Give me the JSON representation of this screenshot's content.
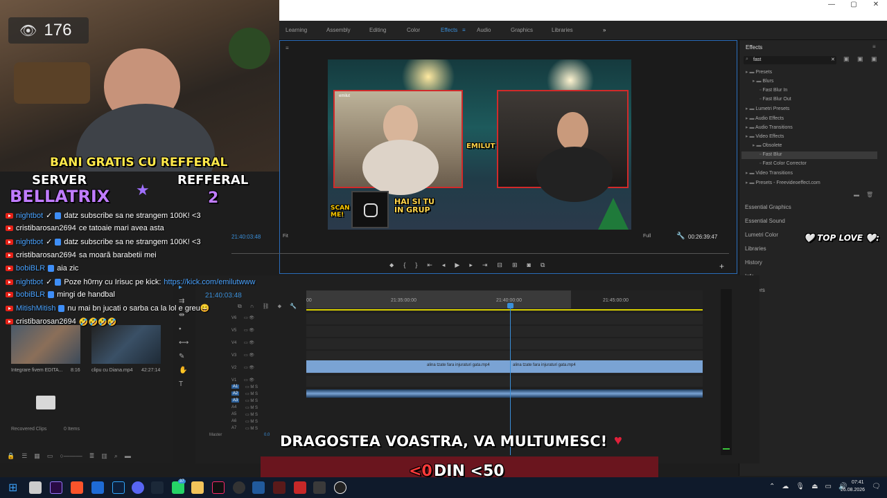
{
  "window": {
    "minimize": "—",
    "maximize": "▢",
    "close": "✕"
  },
  "workspace_tabs": [
    "Learning",
    "Assembly",
    "Editing",
    "Color",
    "Effects",
    "Audio",
    "Graphics",
    "Libraries"
  ],
  "active_tab": "Effects",
  "viewer_count": "176",
  "stream_banner": {
    "line1": "BANI GRATIS CU REFFERAL",
    "server_label": "SERVER",
    "server_name": "BELLATRIX",
    "refferal_label": "REFFERAL",
    "refferal_num": "2"
  },
  "chat": [
    {
      "user": "nightbot",
      "verified": true,
      "mod": true,
      "color": "blue",
      "text": "datz subscribe sa ne strangem 100K! <3"
    },
    {
      "user": "cristibarosan2694",
      "color": "white",
      "text": "ce tatoaie mari avea asta"
    },
    {
      "user": "nightbot",
      "verified": true,
      "mod": true,
      "color": "blue",
      "text": "datz subscribe sa ne strangem 100K! <3"
    },
    {
      "user": "cristibarosan2694",
      "color": "white",
      "text": "sa moară barabetii mei"
    },
    {
      "user": "bobiBLR",
      "mod": true,
      "color": "blue",
      "text": "aia zic"
    },
    {
      "user": "nightbot",
      "verified": true,
      "mod": true,
      "color": "blue",
      "text": "Poze h0rny cu Irisuc pe kick:",
      "link": "https://kick.com/emilutwww"
    },
    {
      "user": "bobiBLR",
      "mod": true,
      "color": "blue",
      "text": "mingi de handbal"
    },
    {
      "user": "MitishMitish",
      "mod": true,
      "color": "blue",
      "text": "nu mai bn jucati o sarba ca la lol e greu😄"
    },
    {
      "user": "cristibarosan2694",
      "color": "white",
      "text": "🤣🤣🤣🤣"
    }
  ],
  "program_monitor": {
    "timecode_left": "21:40:03:48",
    "fit": "Fit",
    "quality": "Full",
    "timecode_right": "00:26:39:47"
  },
  "video_overlay": {
    "group_text_1": "HAI SI TU",
    "group_text_2": "IN GRUP",
    "scan_1": "SCAN",
    "scan_2": "ME!",
    "emilut": "EMILUT",
    "cam_label": "emilut"
  },
  "effects_panel": {
    "title": "Effects",
    "search": "fast",
    "tree": [
      {
        "label": "Presets",
        "level": 0,
        "type": "folder"
      },
      {
        "label": "Blurs",
        "level": 1,
        "type": "folder"
      },
      {
        "label": "Fast Blur In",
        "level": 2,
        "type": "item"
      },
      {
        "label": "Fast Blur Out",
        "level": 2,
        "type": "item"
      },
      {
        "label": "Lumetri Presets",
        "level": 0,
        "type": "folder"
      },
      {
        "label": "Audio Effects",
        "level": 0,
        "type": "folder"
      },
      {
        "label": "Audio Transitions",
        "level": 0,
        "type": "folder"
      },
      {
        "label": "Video Effects",
        "level": 0,
        "type": "folder"
      },
      {
        "label": "Obsolete",
        "level": 1,
        "type": "folder"
      },
      {
        "label": "Fast Blur",
        "level": 2,
        "type": "item"
      },
      {
        "label": "Fast Color Corrector",
        "level": 2,
        "type": "item"
      },
      {
        "label": "Video Transitions",
        "level": 0,
        "type": "folder"
      },
      {
        "label": "Presets - Freevideoeffect.com",
        "level": 0,
        "type": "folder"
      }
    ],
    "selected": "Fast Blur"
  },
  "side_panels": [
    "Essential Graphics",
    "Essential Sound",
    "Lumetri Color",
    "Libraries",
    "History",
    "Info",
    "Markers"
  ],
  "top_love": "🤍 TOP LOVE 🤍:",
  "timeline": {
    "timecode": "21:40:03:48",
    "ruler": [
      "00",
      "21:35:00:00",
      "21:40:00:00",
      "21:45:00:00"
    ],
    "video_tracks": [
      "V6",
      "V5",
      "V4",
      "V3",
      "V2",
      "V1"
    ],
    "audio_tracks": [
      "A1",
      "A2",
      "A3",
      "A4",
      "A5",
      "A6",
      "A7"
    ],
    "master": "Master",
    "master_val": "0.0",
    "clip_name": "alina tzate fara injuraturi gata.mp4"
  },
  "project": {
    "clips": [
      {
        "name": "Integrare fivem EDITA...",
        "dur": "8:16"
      },
      {
        "name": "clipu cu Diana.mp4",
        "dur": "42:27:14"
      }
    ],
    "recovered": "Recovered Clips",
    "items": "0 Items"
  },
  "captions": {
    "line1": "DRAGOSTEA VOASTRA, VA MULTUMESC!",
    "heart": "❤️",
    "line2_a": "<0",
    "line2_b": " DIN <50"
  },
  "taskbar": {
    "time": "07:41",
    "date": "26.08.2026",
    "badge": "37"
  },
  "colors": {
    "accent": "#3a8fd9",
    "clip": "#7aa3d4",
    "playhead": "#3a8fd9",
    "workarea": "#d8d000"
  }
}
